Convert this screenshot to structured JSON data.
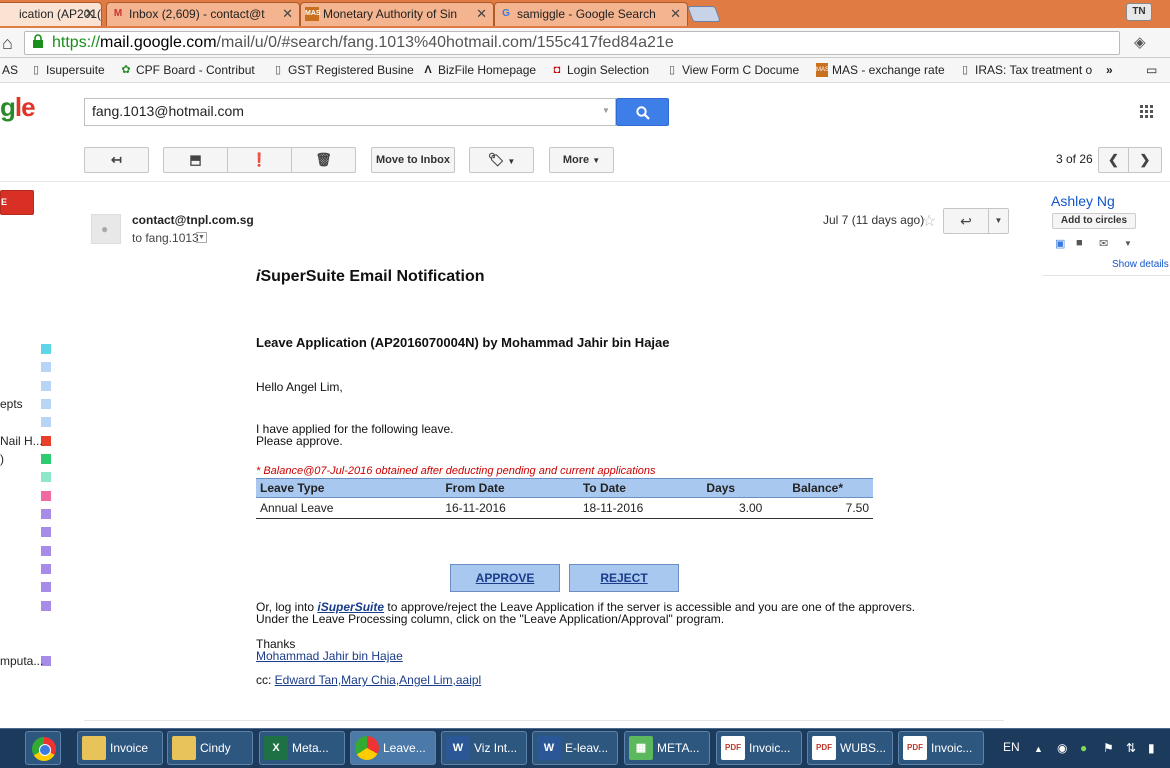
{
  "browser": {
    "tabs": [
      {
        "label": "ication (AP201(",
        "icon": "mail-icon",
        "active": true
      },
      {
        "label": "Inbox (2,609) - contact@t",
        "icon": "gmail-icon"
      },
      {
        "label": "Monetary Authority of Sin",
        "icon": "mas-icon"
      },
      {
        "label": "samiggle - Google Search",
        "icon": "google-icon"
      }
    ],
    "user_badge": "TN",
    "url_scheme": "https://",
    "url_domain": "mail.google.com",
    "url_path": "/mail/u/0/#search/fang.1013%40hotmail.com/155c417fed84a21e",
    "bookmarks": [
      {
        "label": "AS"
      },
      {
        "label": "Isupersuite"
      },
      {
        "label": "CPF Board - Contribut"
      },
      {
        "label": "GST Registered Busine"
      },
      {
        "label": "BizFile Homepage"
      },
      {
        "label": "Login Selection"
      },
      {
        "label": "View Form C Docume"
      },
      {
        "label": "MAS - exchange rate"
      },
      {
        "label": "IRAS: Tax treatment o"
      }
    ],
    "bookmarks_overflow": "»"
  },
  "gmail": {
    "logo_partial": "gle",
    "search_value": "fang.1013@hotmail.com",
    "toolbar": {
      "move_to_inbox": "Move to Inbox",
      "more": "More"
    },
    "pager": "3 of 26",
    "compose_label": "E",
    "left_labels": [
      {
        "text": "epts"
      },
      {
        "text": "Nail H..."
      },
      {
        "text": ")"
      },
      {
        "text": "mputa..."
      }
    ],
    "label_colors": [
      "#5fd6e8",
      "#b8d4f6",
      "#b8d4f6",
      "#b8d4f6",
      "#b8d4f6",
      "#e8402a",
      "#2ecc71",
      "#8ee8c8",
      "#f06ba0",
      "#a78be8",
      "#a78be8",
      "#a78be8",
      "#a78be8",
      "#a78be8",
      "#a78be8",
      "#a78be8"
    ]
  },
  "message": {
    "sender": "contact@tnpl.com.sg",
    "to": "to fang.1013",
    "date": "Jul 7",
    "age": "(11 days ago)"
  },
  "contact_panel": {
    "name": "Ashley Ng",
    "add_circles": "Add to circles",
    "show_details": "Show details"
  },
  "email": {
    "title_i": "i",
    "title_rest": "SuperSuite Email Notification",
    "app_title": "Leave Application (AP2016070004N) by Mohammad Jahir bin Hajae",
    "greeting": "Hello Angel Lim,",
    "line1": "I have applied for the following leave.",
    "line2": "Please approve.",
    "balance_note": "* Balance@07-Jul-2016 obtained after deducting pending and current applications",
    "table": {
      "headers": [
        "Leave Type",
        "From Date",
        "To Date",
        "Days",
        "Balance*"
      ],
      "rows": [
        [
          "Annual Leave",
          "16-11-2016",
          "18-11-2016",
          "3.00",
          "7.50"
        ]
      ]
    },
    "approve": "APPROVE",
    "reject": "REJECT",
    "login_pre": "Or, log into ",
    "login_link": "iSuperSuite",
    "login_post": " to approve/reject the Leave Application if the server is accessible and you are one of the approvers.",
    "login_line2": "Under the Leave Processing column, click on the \"Leave Application/Approval\" program.",
    "thanks": "Thanks",
    "signature": "Mohammad Jahir bin Hajae",
    "cc_label": "cc: ",
    "cc_list": "Edward Tan,Mary Chia,Angel Lim,aaipl"
  },
  "taskbar": {
    "items": [
      {
        "label": "Invoice",
        "icon": "folder-icon",
        "color": "#e8c35a"
      },
      {
        "label": "Cindy",
        "icon": "folder-icon",
        "color": "#e8c35a"
      },
      {
        "label": "Meta...",
        "icon": "excel-icon",
        "color": "#1e7145"
      },
      {
        "label": "Leave...",
        "icon": "chrome-icon",
        "color": "#e33"
      },
      {
        "label": "Viz Int...",
        "icon": "word-icon",
        "color": "#2b5797"
      },
      {
        "label": "E-leav...",
        "icon": "word-icon",
        "color": "#2b5797"
      },
      {
        "label": "META...",
        "icon": "app-icon",
        "color": "#5cb85c"
      },
      {
        "label": "Invoic...",
        "icon": "pdf-icon",
        "color": "#c0392b"
      },
      {
        "label": "WUBS...",
        "icon": "pdf-icon",
        "color": "#c0392b"
      },
      {
        "label": "Invoic...",
        "icon": "pdf-icon",
        "color": "#c0392b"
      }
    ],
    "lang": "EN"
  }
}
